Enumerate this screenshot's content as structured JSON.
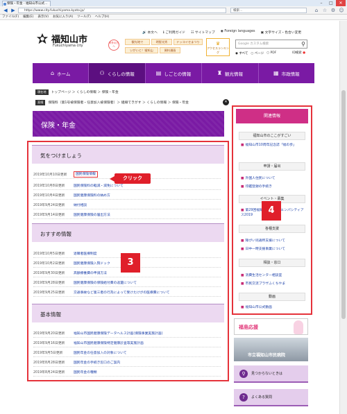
{
  "browser": {
    "tab_title": "保険・年金 - 福知山市公式...",
    "address": "https://www.city.fukuchiyama.kyoto.jp/",
    "search_placeholder": "検索...",
    "menu": [
      "ファイル(F)",
      "編集(E)",
      "表示(V)",
      "お気に入り(A)",
      "ツール(T)",
      "ヘルプ(H)"
    ]
  },
  "header": {
    "title": "福知山市",
    "subtitle": "Fukuchiyama city",
    "sightseeing_badge": "市外の方へ",
    "tags": [
      "観光地で",
      "明智光秀",
      "ドッコイセまつり",
      "いがいと！福知山",
      "資料漫画"
    ],
    "topnav": [
      "本文へ",
      "ご利用ガイド",
      "サイトマップ",
      "Foreign languages",
      "文字サイズ・色合い変更"
    ],
    "ranking_label": "アクセスランキング",
    "search_placeholder": "Google カスタム検索",
    "radio": [
      "すべて",
      "ページ",
      "PDF"
    ],
    "id_search": "ID検索"
  },
  "gnav": [
    {
      "label": "ホーム",
      "icon": "home-icon"
    },
    {
      "label": "くらしの情報",
      "icon": "family-icon"
    },
    {
      "label": "しごとの情報",
      "icon": "briefcase-icon"
    },
    {
      "label": "観光情報",
      "icon": "castle-icon"
    },
    {
      "label": "市政情報",
      "icon": "building-icon"
    }
  ],
  "breadcrumbs": {
    "tag1": "現在地",
    "path1": "トップページ ＞ くらしの情報 ＞ 保険・年金",
    "tag2": "直線",
    "path2": "保険料（第1号被保険者・任意加入被保険者）＞ 組織できがす ＞ くらしの情報 ＞ 保険・年金"
  },
  "page_title": "保険・年金",
  "sections": [
    {
      "heading": "気をつけましょう",
      "rows": [
        {
          "date": "2019年10月10日更新",
          "text": "国民保険情報"
        },
        {
          "date": "2019年10月8日更新",
          "text": "国民保険料の軽減・減免について"
        },
        {
          "date": "2019年10月4日更新",
          "text": "国民健康保険料の納め方"
        },
        {
          "date": "2019年9月24日更新",
          "text": "納付相談"
        },
        {
          "date": "2019年9月14日更新",
          "text": "国民健康保険の届出方法"
        }
      ]
    },
    {
      "heading": "おすすめ情報",
      "rows": [
        {
          "date": "2019年10月5日更新",
          "text": "退職者医療制度"
        },
        {
          "date": "2019年10月2日更新",
          "text": "国民健康保険入院ドック"
        },
        {
          "date": "2019年9月30日更新",
          "text": "高額療養費の申請方法"
        },
        {
          "date": "2019年9月28日更新",
          "text": "国民健康保険の保険給付費の返還について"
        },
        {
          "date": "2019年9月25日更新",
          "text": "交通事故など第三者の行為によって受けたけがの医療費について"
        }
      ]
    },
    {
      "heading": "基本情報",
      "rows": [
        {
          "date": "2019年9月20日更新",
          "text": "福知山市国民健康保険データヘルス計画(保険事業実施計画)"
        },
        {
          "date": "2019年9月16日更新",
          "text": "福知山市国民健康保険特定健康診査等実施計画"
        },
        {
          "date": "2019年9月5日更新",
          "text": "国民年金の任意加入の対象について"
        },
        {
          "date": "2019年8月28日更新",
          "text": "国民年金の手続き窓口のご案内"
        },
        {
          "date": "2019年8月24日更新",
          "text": "国民年金の種類"
        }
      ]
    }
  ],
  "annotations": {
    "click_label": "クリック",
    "main_number": "3",
    "side_number": "4"
  },
  "sidebar": {
    "heading": "関連情報",
    "groups": [
      {
        "title": "福知山市のここがすごい",
        "links": [
          "福知山市10周年記念誌「福の歩」"
        ]
      },
      {
        "title": "申請・届出",
        "links": [
          "外国人住民について",
          "印鑑登録の手続き"
        ]
      },
      {
        "title": "イベント・募集",
        "links": [
          "第29回福知山マラソン エンパシティアス2019"
        ]
      },
      {
        "title": "各種支援",
        "links": [
          "障がい児通所支援について",
          "日中一時支援事業について"
        ]
      },
      {
        "title": "相談・窓口",
        "links": [
          "消費生活センター相談室",
          "市民交流プラザふくちやま"
        ]
      },
      {
        "title": "動画",
        "links": [
          "福知山市公式動画"
        ]
      }
    ]
  },
  "banners": {
    "b1": "福島応援",
    "b2": "市立福知山市民病院",
    "b3": "見つからないときは",
    "b4": "よくある質問"
  }
}
